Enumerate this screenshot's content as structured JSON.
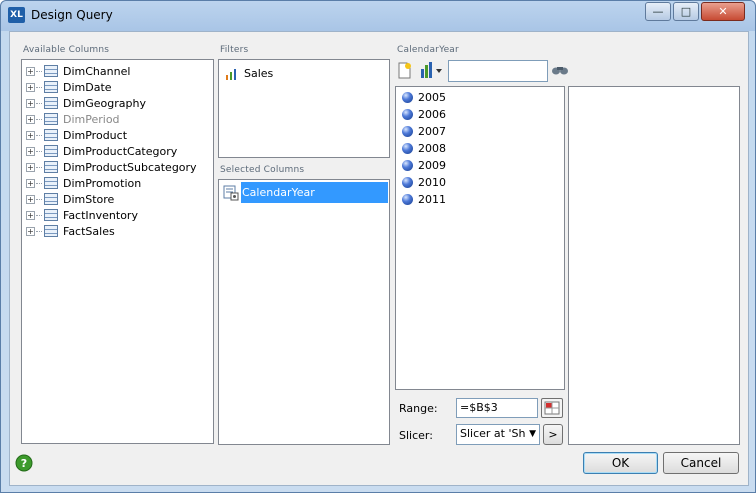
{
  "window": {
    "title": "Design Query",
    "app_icon": "XL",
    "controls": {
      "minimize": "—",
      "maximize": "□",
      "close": "✕"
    }
  },
  "available_columns": {
    "label": "Available Columns",
    "items": [
      {
        "label": "DimChannel",
        "dim": false
      },
      {
        "label": "DimDate",
        "dim": false
      },
      {
        "label": "DimGeography",
        "dim": false
      },
      {
        "label": "DimPeriod",
        "dim": true
      },
      {
        "label": "DimProduct",
        "dim": false
      },
      {
        "label": "DimProductCategory",
        "dim": false
      },
      {
        "label": "DimProductSubcategory",
        "dim": false
      },
      {
        "label": "DimPromotion",
        "dim": false
      },
      {
        "label": "DimStore",
        "dim": false
      },
      {
        "label": "FactInventory",
        "dim": false
      },
      {
        "label": "FactSales",
        "dim": false
      }
    ]
  },
  "filters": {
    "label": "Filters",
    "items": [
      {
        "label": "Sales",
        "icon": "bar-chart-icon"
      }
    ]
  },
  "selected_columns": {
    "label": "Selected Columns",
    "items": [
      {
        "label": "CalendarYear",
        "icon": "column-icon",
        "selected": true
      }
    ]
  },
  "calendar_year": {
    "label": "CalendarYear",
    "search_value": "",
    "values": [
      "2005",
      "2006",
      "2007",
      "2008",
      "2009",
      "2010",
      "2011"
    ]
  },
  "range": {
    "label": "Range:",
    "value": "=$B$3"
  },
  "slicer": {
    "label": "Slicer:",
    "value": "Slicer at 'Sh",
    "go_label": ">"
  },
  "buttons": {
    "ok": "OK",
    "cancel": "Cancel"
  },
  "colors": {
    "selection": "#3399ff",
    "accent": "#1f5fa8"
  }
}
